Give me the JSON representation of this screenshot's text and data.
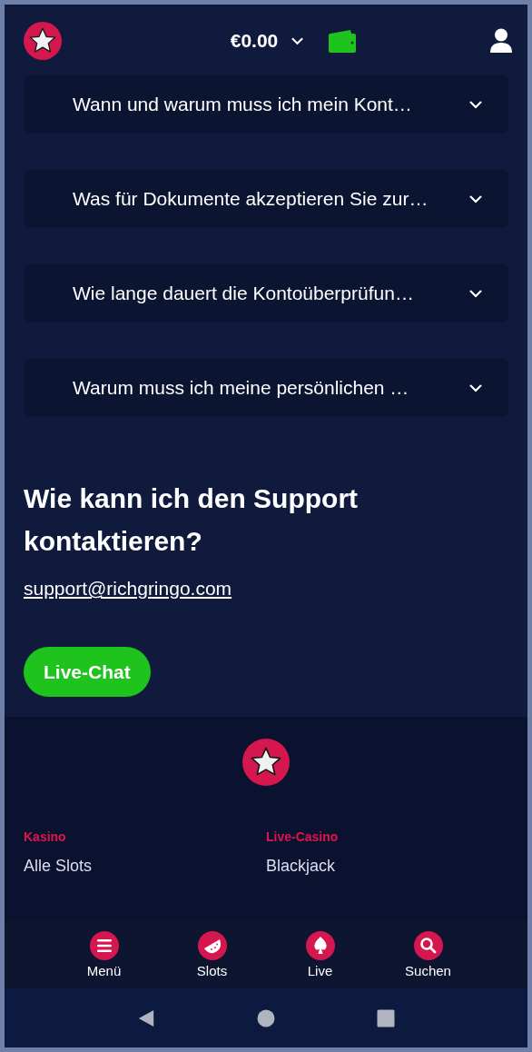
{
  "header": {
    "balance": "€0.00"
  },
  "faq": [
    {
      "question": "Wann und warum muss ich mein Kont…",
      "expanded": false
    },
    {
      "question": "Was für Dokumente akzeptieren Sie zur…",
      "expanded": false
    },
    {
      "question": "Wie lange dauert die Kontoüberprüfun…",
      "expanded": false
    },
    {
      "question": "Warum muss ich meine persönlichen …",
      "expanded": false
    }
  ],
  "support": {
    "heading": "Wie kann ich den Support kontaktieren?",
    "email": "support@richgringo.com",
    "button": "Live-Chat"
  },
  "footer": {
    "columns": [
      {
        "title": "Kasino",
        "links": [
          "Alle Slots"
        ]
      },
      {
        "title": "Live-Casino",
        "links": [
          "Blackjack"
        ]
      }
    ]
  },
  "bottom_nav": [
    {
      "kind": "menu",
      "label": "Menü"
    },
    {
      "kind": "slots",
      "label": "Slots"
    },
    {
      "kind": "live",
      "label": "Live"
    },
    {
      "kind": "search",
      "label": "Suchen"
    }
  ]
}
